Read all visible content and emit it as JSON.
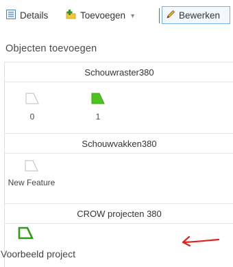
{
  "toolbar": {
    "details_label": "Details",
    "toevoegen_label": "Toevoegen",
    "bewerken_label": "Bewerken",
    "details_icon": "details-list-icon",
    "toevoegen_icon": "add-feature-icon",
    "bewerken_icon": "pencil-icon"
  },
  "panel": {
    "title": "Objecten toevoegen",
    "layers": [
      {
        "name": "Schouwraster380",
        "templates": [
          {
            "label": "0",
            "symbol": "white-polygon-icon"
          },
          {
            "label": "1",
            "symbol": "green-filled-polygon-icon"
          }
        ]
      },
      {
        "name": "Schouwvakken380",
        "templates": [
          {
            "label": "New Feature",
            "symbol": "white-polygon-icon"
          }
        ]
      },
      {
        "name": "CROW projecten 380",
        "templates": [
          {
            "label": "Voorbeeld project",
            "symbol": "green-outline-polygon-icon"
          }
        ]
      }
    ]
  },
  "annotation": {
    "arrow_icon": "red-arrow-icon",
    "arrow_color": "#e0201b"
  },
  "colors": {
    "accent_border": "#7aaee0",
    "fill_green": "#4fc21d",
    "outline_green": "#2e9b10"
  }
}
